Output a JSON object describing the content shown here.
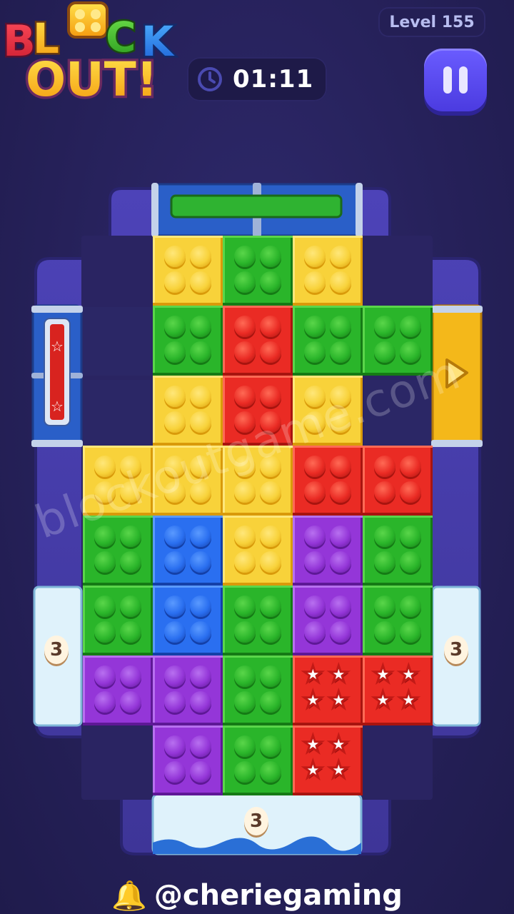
{
  "header": {
    "logo_line1": "BLOCK",
    "logo_line2": "OUT!",
    "level_label": "Level 155",
    "timer": "01:11",
    "pause_icon": "pause-icon",
    "clock_icon": "clock-icon"
  },
  "board": {
    "colors": {
      "yellow": "#f5c21b",
      "green": "#22a31f",
      "red": "#e52520",
      "blue": "#1e63e0",
      "purple": "#8a2ed0",
      "frame": "#4a3fb0",
      "frame_dark": "#3a3190",
      "ice": "#dff2fb"
    },
    "gates": {
      "left_count": "3",
      "right_count": "3",
      "bottom_count": "3"
    }
  },
  "watermark": "blockoutgame.com",
  "credit": {
    "bell_icon": "bell-icon",
    "handle": "@cheriegaming"
  }
}
